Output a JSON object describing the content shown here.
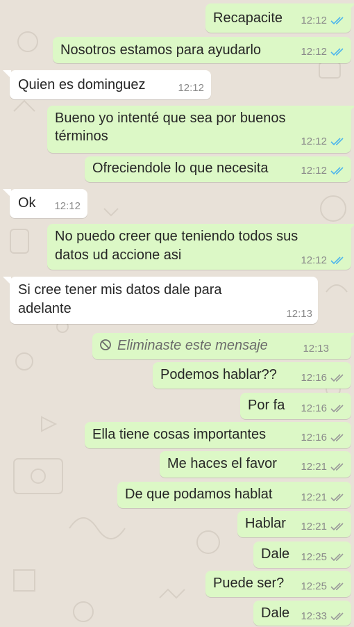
{
  "colors": {
    "outgoing_bubble": "#dcf8c6",
    "incoming_bubble": "#ffffff",
    "background": "#e8e1d8",
    "read_ticks": "#4fb6ec",
    "delivered_ticks": "#9a9a9a"
  },
  "messages": [
    {
      "direction": "out",
      "text": "Recapacite",
      "time": "12:12",
      "status": "read"
    },
    {
      "direction": "out",
      "text": "Nosotros estamos para ayudarlo",
      "time": "12:12",
      "status": "read"
    },
    {
      "direction": "in",
      "text": "Quien es dominguez",
      "time": "12:12"
    },
    {
      "direction": "out",
      "lines": [
        "Bueno yo intenté que sea por buenos",
        "términos"
      ],
      "time": "12:12",
      "status": "read"
    },
    {
      "direction": "out",
      "text": "Ofreciendole lo que necesita",
      "time": "12:12",
      "status": "read"
    },
    {
      "direction": "in",
      "text": "Ok",
      "time": "12:12"
    },
    {
      "direction": "out",
      "lines": [
        "No puedo creer que teniendo todos sus",
        "datos ud accione asi"
      ],
      "time": "12:12",
      "status": "read"
    },
    {
      "direction": "in",
      "lines": [
        "Si cree tener mis datos dale para",
        "adelante"
      ],
      "time": "12:13"
    },
    {
      "direction": "out",
      "deleted": true,
      "text": "Eliminaste este mensaje",
      "time": "12:13",
      "icon": "blocked-circle-icon"
    },
    {
      "direction": "out",
      "text": "Podemos hablar??",
      "time": "12:16",
      "status": "delivered"
    },
    {
      "direction": "out",
      "text": "Por fa",
      "time": "12:16",
      "status": "delivered"
    },
    {
      "direction": "out",
      "text": "Ella tiene cosas importantes",
      "time": "12:16",
      "status": "delivered"
    },
    {
      "direction": "out",
      "text": "Me haces el favor",
      "time": "12:21",
      "status": "delivered"
    },
    {
      "direction": "out",
      "text": "De que podamos hablat",
      "time": "12:21",
      "status": "delivered"
    },
    {
      "direction": "out",
      "text": "Hablar",
      "time": "12:21",
      "status": "delivered"
    },
    {
      "direction": "out",
      "text": "Dale",
      "time": "12:25",
      "status": "delivered"
    },
    {
      "direction": "out",
      "text": "Puede ser?",
      "time": "12:25",
      "status": "delivered"
    },
    {
      "direction": "out",
      "text": "Dale",
      "time": "12:33",
      "status": "delivered"
    }
  ]
}
